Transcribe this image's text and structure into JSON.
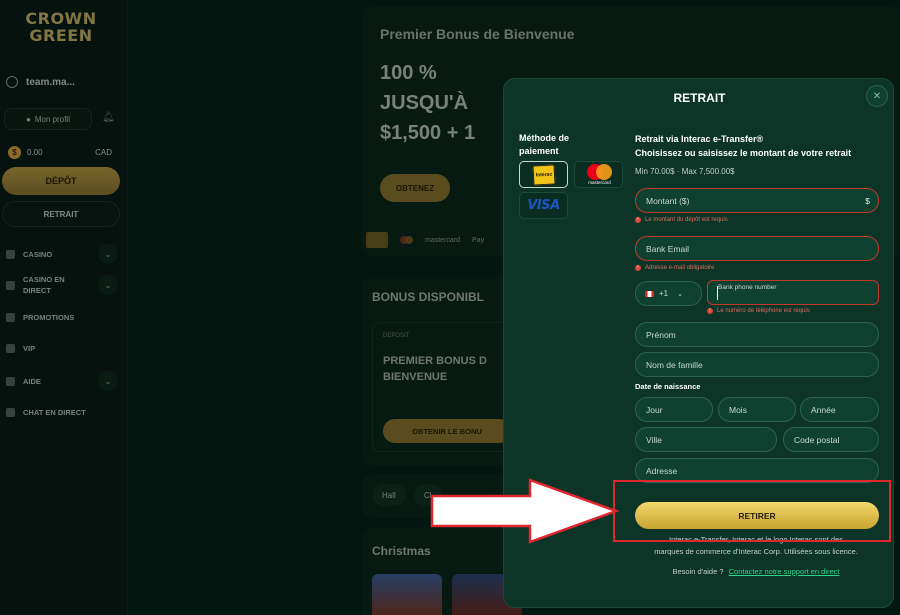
{
  "sidebar": {
    "logo_line1": "CROWN",
    "logo_line2": "GREEN",
    "username": "team.ma...",
    "profile_label": "Mon profil",
    "balance": "0.00",
    "currency": "CAD",
    "deposit_label": "DÉPÔT",
    "withdraw_label": "RETRAIT",
    "nav": [
      {
        "label": "CASINO",
        "icon": "spade-icon",
        "expandable": true
      },
      {
        "label": "CASINO EN DIRECT",
        "icon": "cards-icon",
        "expandable": true
      },
      {
        "label": "PROMOTIONS",
        "icon": "gift-icon",
        "expandable": false
      },
      {
        "label": "VIP",
        "icon": "crown-icon",
        "expandable": false
      },
      {
        "label": "AIDE",
        "icon": "help-icon",
        "expandable": true
      },
      {
        "label": "CHAT EN DIRECT",
        "icon": "chat-icon",
        "expandable": false
      }
    ]
  },
  "background": {
    "hero_subtitle": "Premier Bonus de Bienvenue",
    "hero_title": "100 % JUSQU'À $1,500 + 1",
    "hero_button": "OBTENEZ",
    "payment_labels": [
      "mastercard",
      "Pay"
    ],
    "bonus_heading": "BONUS DISPONIBL",
    "bonus_tag": "DEPOSIT",
    "bonus_name": "PREMIER BONUS D BIENVENUE",
    "bonus_button": "OBTENIR LE BONU",
    "chips": [
      "Hall",
      "Cl"
    ],
    "section_title": "Christmas"
  },
  "modal": {
    "title": "RETRAIT",
    "method_label": "Méthode de paiement",
    "methods": [
      {
        "name": "Interac",
        "selected": true
      },
      {
        "name": "mastercard",
        "selected": false
      },
      {
        "name": "VISA",
        "selected": false
      }
    ],
    "heading_line1": "Retrait via Interac e-Transfer®",
    "heading_line2": "Choisissez ou saisissez le montant de votre retrait",
    "limits": "Min 70.00$ · Max 7,500.00$",
    "amount_placeholder": "Montant ($)",
    "amount_symbol": "$",
    "amount_error": "Le montant du dépôt est requis",
    "email_placeholder": "Bank Email",
    "email_error": "Adresse e-mail obligatoire",
    "phone_prefix": "+1",
    "phone_placeholder": "Bank phone number",
    "phone_error": "Le numéro de téléphone est requis",
    "first_name": "Prénom",
    "last_name": "Nom de famille",
    "dob_label": "Date de naissance",
    "day": "Jour",
    "month": "Mois",
    "year": "Année",
    "city": "Ville",
    "postal": "Code postal",
    "address": "Adresse",
    "submit": "RETIRER",
    "legal_line1": "Interac e-Transfer, Interac et le logo Interac sont des",
    "legal_line2": "marques de commerce d'Interac Corp. Utilisées sous licence.",
    "help_text": "Besoin d'aide ?",
    "help_link": "Contactez notre support en direct"
  },
  "colors": {
    "accent_gold": "#e3c453",
    "error_red": "#c0392b",
    "link_green": "#2fd38a",
    "annotation_red": "#e0262e"
  }
}
